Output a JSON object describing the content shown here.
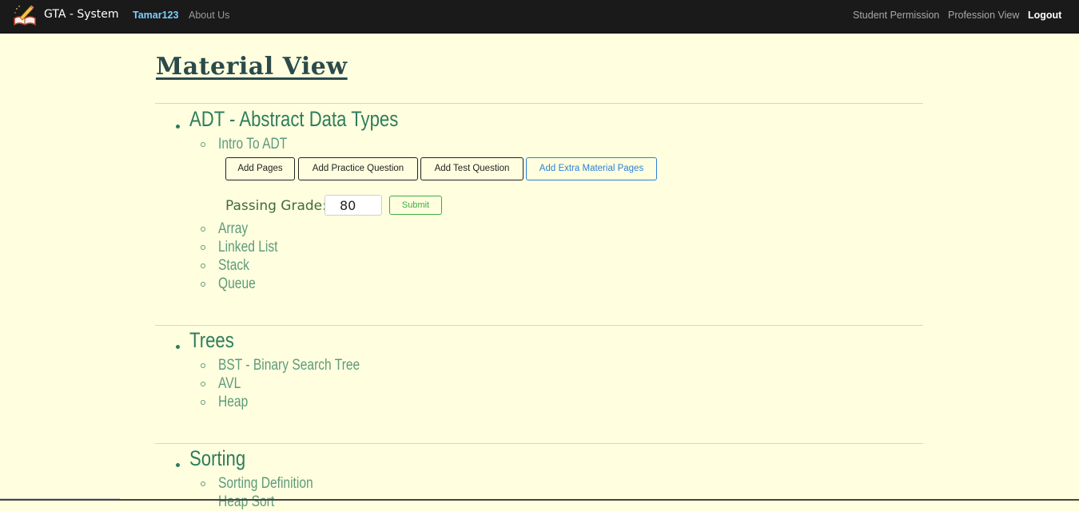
{
  "navbar": {
    "brand_icon": "book-pencil-icon",
    "brand": "GTA - System",
    "user": "Tamar123",
    "about": "About Us",
    "student_permission": "Student Permission",
    "profession_view": "Profession View",
    "logout": "Logout"
  },
  "page": {
    "title": "Material View"
  },
  "sections": [
    {
      "title": "ADT - Abstract Data Types",
      "items": [
        "Intro To ADT",
        "Array",
        "Linked List",
        "Stack",
        "Queue"
      ],
      "expanded_item": "Intro To ADT"
    },
    {
      "title": "Trees",
      "items": [
        "BST - Binary Search Tree",
        "AVL",
        "Heap"
      ]
    },
    {
      "title": "Sorting",
      "items": [
        "Sorting Definition",
        "Heap Sort"
      ]
    }
  ],
  "actions": {
    "add_pages": "Add Pages",
    "add_practice_question": "Add Practice Question",
    "add_test_question": "Add Test Question",
    "add_extra_material_pages": "Add Extra Material Pages"
  },
  "passing_grade": {
    "label": "Passing Grade:",
    "value": "80",
    "submit": "Submit"
  },
  "colors": {
    "background": "#ffffe0",
    "navbar": "#1a1a1a",
    "section_title": "#2e7d5b",
    "sub_item": "#5c9a7a",
    "accent_blue": "#2b7fd6",
    "submit_green": "#3faa3f"
  }
}
